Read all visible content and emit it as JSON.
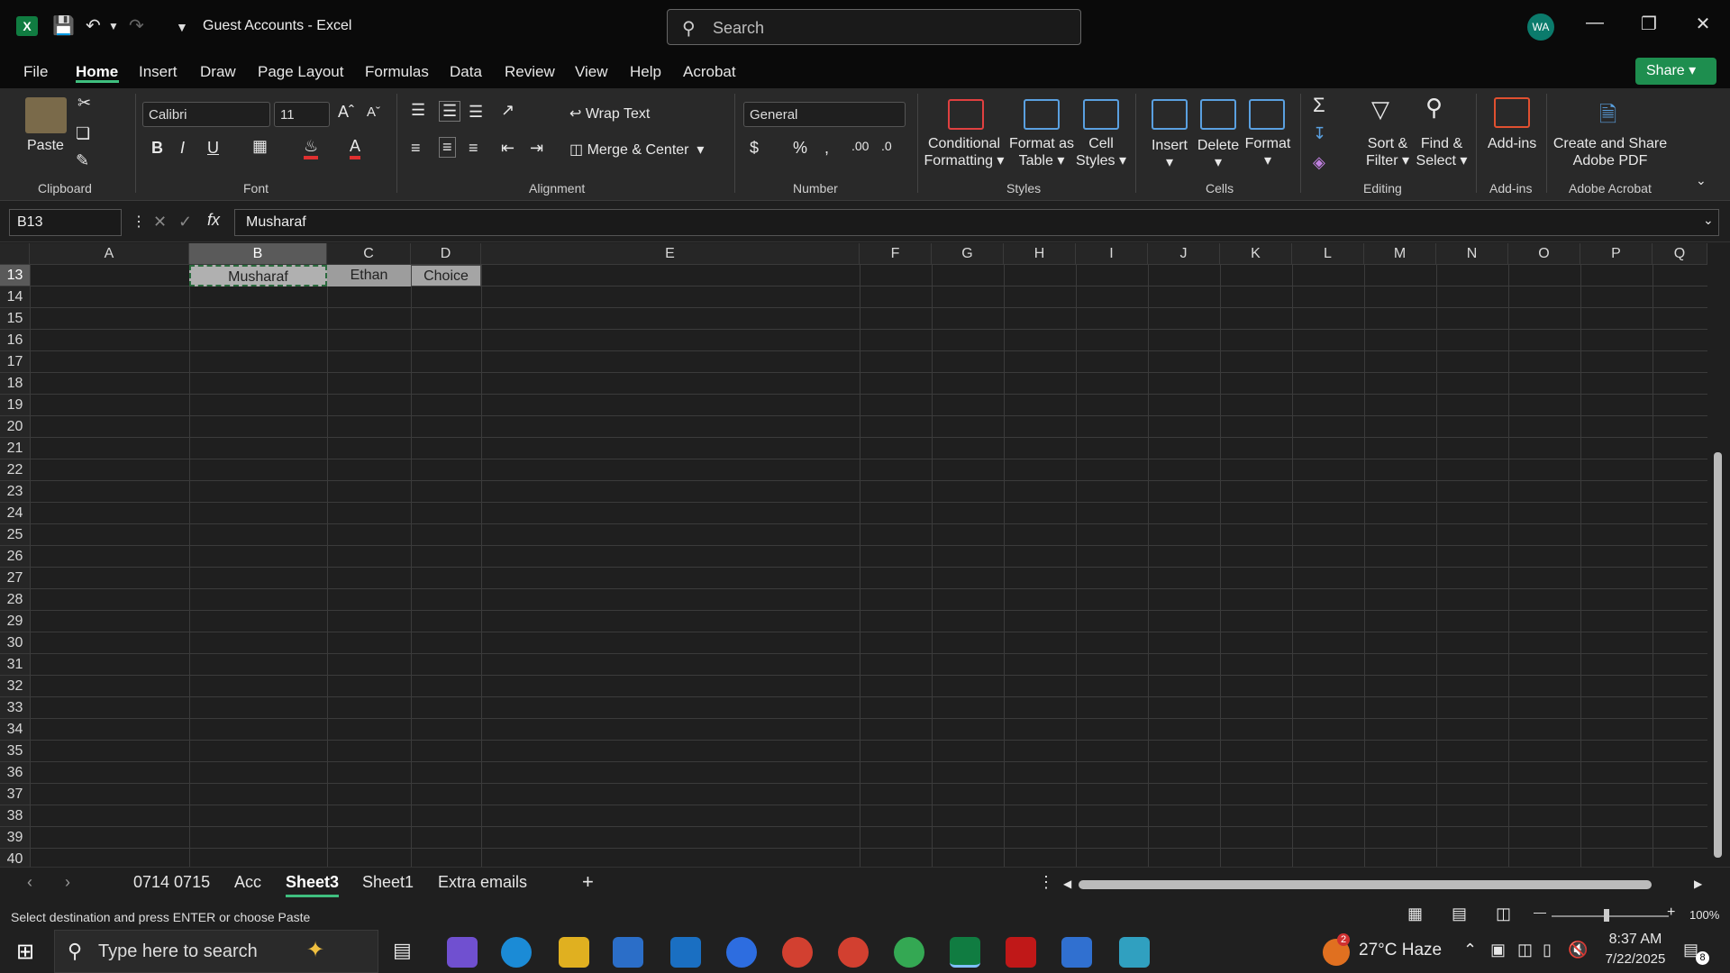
{
  "window": {
    "title": "Guest Accounts  -  Excel",
    "search_placeholder": "Search",
    "avatar_initials": "WA",
    "share_label": "Share"
  },
  "menu": [
    "File",
    "Home",
    "Insert",
    "Draw",
    "Page Layout",
    "Formulas",
    "Data",
    "Review",
    "View",
    "Help",
    "Acrobat"
  ],
  "ribbon": {
    "clipboard": {
      "paste": "Paste",
      "group": "Clipboard"
    },
    "font": {
      "family": "Calibri",
      "size": "11",
      "group": "Font"
    },
    "alignment": {
      "wrap": "Wrap Text",
      "merge": "Merge & Center",
      "group": "Alignment"
    },
    "number": {
      "format": "General",
      "group": "Number"
    },
    "styles": {
      "cond1": "Conditional",
      "cond2": "Formatting",
      "fmt1": "Format as",
      "fmt2": "Table",
      "cell1": "Cell",
      "cell2": "Styles",
      "group": "Styles"
    },
    "cells": {
      "insert": "Insert",
      "delete": "Delete",
      "format": "Format",
      "group": "Cells"
    },
    "editing": {
      "sort1": "Sort &",
      "sort2": "Filter",
      "find1": "Find &",
      "find2": "Select",
      "group": "Editing"
    },
    "addins": {
      "label": "Add-ins",
      "group": "Add-ins"
    },
    "acrobat": {
      "l1": "Create and Share",
      "l2": "Adobe PDF",
      "group": "Adobe Acrobat"
    }
  },
  "formula_bar": {
    "name_box": "B13",
    "content": "Musharaf"
  },
  "columns": [
    "A",
    "B",
    "C",
    "D",
    "E",
    "F",
    "G",
    "H",
    "I",
    "J",
    "K",
    "L",
    "M",
    "N",
    "O",
    "P",
    "Q"
  ],
  "rows": [
    "13",
    "14",
    "15",
    "16",
    "17",
    "18",
    "19",
    "20",
    "21",
    "22",
    "23",
    "24",
    "25",
    "26",
    "27",
    "28",
    "29",
    "30",
    "31",
    "32",
    "33",
    "34",
    "35",
    "36",
    "37",
    "38",
    "39",
    "40"
  ],
  "cells": {
    "B13": "Musharaf",
    "C13": "Ethan",
    "D13": "Choice"
  },
  "sheets": [
    "0714 0715",
    "Acc",
    "Sheet3",
    "Sheet1",
    "Extra emails"
  ],
  "active_sheet": "Sheet3",
  "status": {
    "message": "Select destination and press ENTER or choose Paste",
    "zoom": "100%"
  },
  "taskbar": {
    "search_placeholder": "Type here to search",
    "weather": "27°C  Haze",
    "time": "8:37 AM",
    "date": "7/22/2025",
    "notification_count": "8",
    "weather_badge": "2"
  }
}
